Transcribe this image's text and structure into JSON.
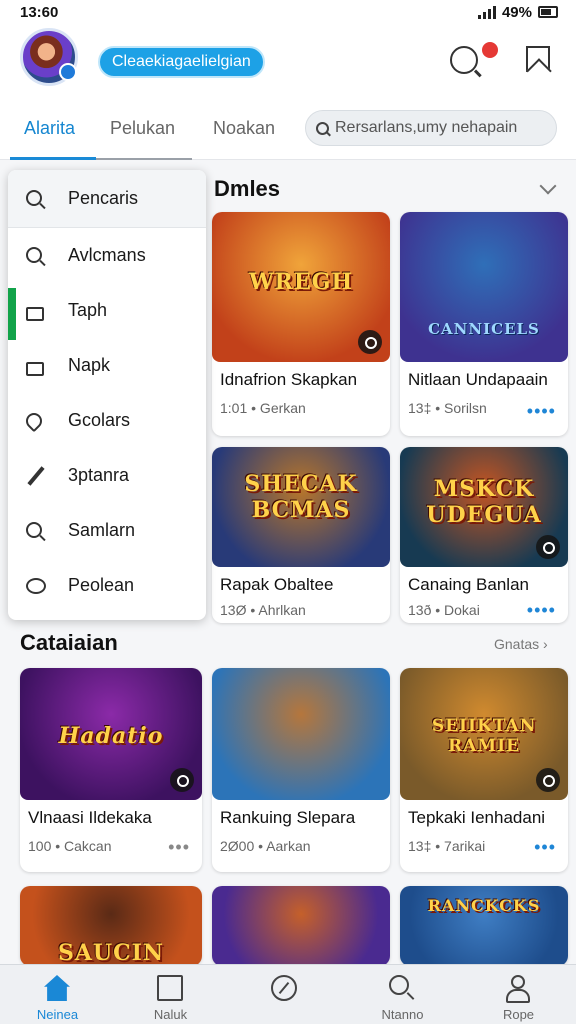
{
  "status_bar": {
    "time": "13:60",
    "battery": "49%"
  },
  "header": {
    "username": "Cleaekiagaelielgian"
  },
  "tabs": [
    {
      "label": "Alarita"
    },
    {
      "label": "Pelukan"
    },
    {
      "label": "Noakan"
    }
  ],
  "search": {
    "placeholder": "Rersarlans,umy nehapain"
  },
  "menu": {
    "items": [
      {
        "label": "Pencaris"
      },
      {
        "label": "Avlcmans"
      },
      {
        "label": "Taph"
      },
      {
        "label": "Napk"
      },
      {
        "label": "Gcolars"
      },
      {
        "label": "3ptanra"
      },
      {
        "label": "Samlarn"
      },
      {
        "label": "Peolean"
      }
    ]
  },
  "sections": {
    "first": {
      "title": "Dmles"
    },
    "second": {
      "title": "Cataiaian",
      "see_all": "Gnatas"
    }
  },
  "cards": [
    {
      "title": "Idnafrion Skapkan",
      "meta": "1:01 • Gerkan",
      "logo": "WREGH",
      "colors": [
        "#c2411a",
        "#f0a43a"
      ]
    },
    {
      "title": "Nitlaan Undapaain",
      "meta": "13‡ • Sorilsn",
      "logo": "CANNICELS",
      "colors": [
        "#3e3290",
        "#2f6fb8"
      ]
    },
    {
      "title": "Rapak Obaltee",
      "meta": "13Ø • Ahrlkan",
      "logo": "SHECAK BCMAS",
      "colors": [
        "#283a78",
        "#b8762a"
      ]
    },
    {
      "title": "Canaing Banlan",
      "meta": "13ð • Dokai",
      "logo": "MSKCK UDEGUA",
      "colors": [
        "#173a52",
        "#c45522"
      ]
    },
    {
      "title": "Vlnaasi Ildekaka",
      "meta": "100 • Cakcan",
      "logo": "Hadatio",
      "colors": [
        "#3d1260",
        "#8b2aa8"
      ]
    },
    {
      "title": "Rankuing Slepara",
      "meta": "2Ø00 • Aarkan",
      "logo": "",
      "colors": [
        "#2c74b8",
        "#b5763c"
      ]
    },
    {
      "title": "Tepkaki Ienhadani",
      "meta": "13‡ • 7arikai",
      "logo": "SEIIKTAN RAMIE",
      "colors": [
        "#7a5a2a",
        "#d08a2f"
      ]
    },
    {
      "title": "",
      "meta": "",
      "logo": "SAUCIN",
      "colors": [
        "#c4511c",
        "#5a2a16"
      ]
    },
    {
      "title": "",
      "meta": "",
      "logo": "",
      "colors": [
        "#4a2a90",
        "#c5602a"
      ]
    },
    {
      "title": "",
      "meta": "",
      "logo": "RANCKCKS",
      "colors": [
        "#1e4d8c",
        "#3f7ec4"
      ]
    }
  ],
  "bottom_nav": [
    {
      "label": "Neinea"
    },
    {
      "label": "Naluk"
    },
    {
      "label": ""
    },
    {
      "label": "Ntanno"
    },
    {
      "label": "Rope"
    }
  ]
}
